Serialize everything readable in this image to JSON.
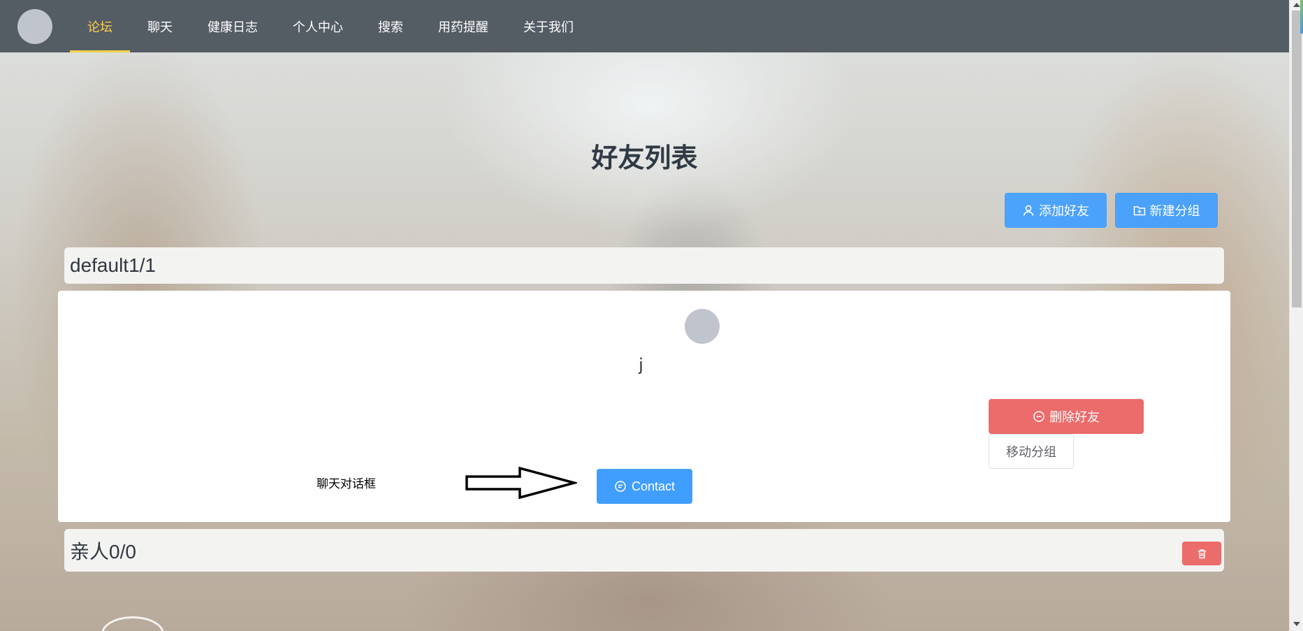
{
  "nav": {
    "items": [
      {
        "label": "论坛",
        "active": true
      },
      {
        "label": "聊天",
        "active": false
      },
      {
        "label": "健康日志",
        "active": false
      },
      {
        "label": "个人中心",
        "active": false
      },
      {
        "label": "搜索",
        "active": false
      },
      {
        "label": "用药提醒",
        "active": false
      },
      {
        "label": "关于我们",
        "active": false
      }
    ]
  },
  "page": {
    "title": "好友列表"
  },
  "toolbar": {
    "add_friend_label": "添加好友",
    "new_group_label": "新建分组"
  },
  "groups": [
    {
      "title": "default1/1",
      "friends": [
        {
          "name": "j",
          "delete_label": "删除好友",
          "move_label": "移动分组",
          "contact_label": "Contact"
        }
      ]
    },
    {
      "title": "亲人0/0",
      "friends": []
    }
  ],
  "annotation": {
    "text": "聊天对话框"
  },
  "colors": {
    "navbar_bg": "#545c64",
    "nav_active": "#ffd04b",
    "primary": "#409eff",
    "danger": "#ec6b6b"
  },
  "icons": {
    "add_friend": "user-icon",
    "new_group": "folder-add-icon",
    "delete_friend": "remove-circle-icon",
    "contact": "chat-bubble-icon",
    "delete_group": "trash-icon"
  }
}
